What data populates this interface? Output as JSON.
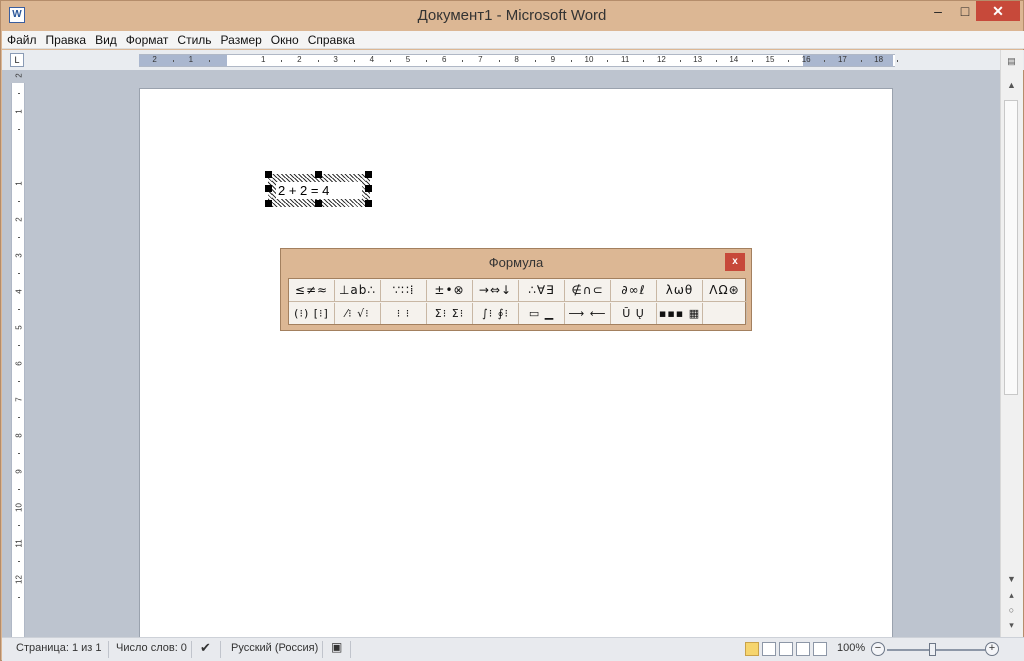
{
  "window": {
    "title": "Документ1 - Microsoft Word",
    "app_icon": "word-icon",
    "controls": {
      "minimize": "–",
      "maximize": "□",
      "close": "✕"
    }
  },
  "menu": [
    "Файл",
    "Правка",
    "Вид",
    "Формат",
    "Стиль",
    "Размер",
    "Окно",
    "Справка"
  ],
  "ruler": {
    "horizontal_labels": [
      "2",
      "1",
      "1",
      "2",
      "3",
      "4",
      "5",
      "6",
      "7",
      "8",
      "9",
      "10",
      "11",
      "12",
      "13",
      "14",
      "15",
      "16",
      "17",
      "18"
    ],
    "vertical_labels": [
      "2",
      "1",
      "1",
      "2",
      "3",
      "4",
      "5",
      "6",
      "7",
      "8",
      "9",
      "10",
      "11",
      "12"
    ]
  },
  "document": {
    "equation_text": "2 + 2 = 4"
  },
  "formula_palette": {
    "title": "Формула",
    "close": "x",
    "row1": [
      "≤≠≈",
      "⊥ab∴",
      "∵∷⁞",
      "±•⊗",
      "→⇔↓",
      "∴∀∃",
      "∉∩⊂",
      "∂∞ℓ",
      "λωθ",
      "ΛΩ⊛"
    ],
    "row2": [
      "(⁝) [⁝]",
      "⁄⁝ √⁝",
      "⁝ ⁝",
      "Σ⁝ Σ⁝",
      "∫⁝ ∮⁝",
      "▭ ▁",
      "⟶ ⟵",
      "Ū Ų",
      "▪▪▪ ▦",
      ""
    ]
  },
  "statusbar": {
    "page": "Страница: 1 из 1",
    "words": "Число слов: 0",
    "language": "Русский (Россия)",
    "zoom": "100%",
    "zoom_minus": "−",
    "zoom_plus": "+"
  }
}
